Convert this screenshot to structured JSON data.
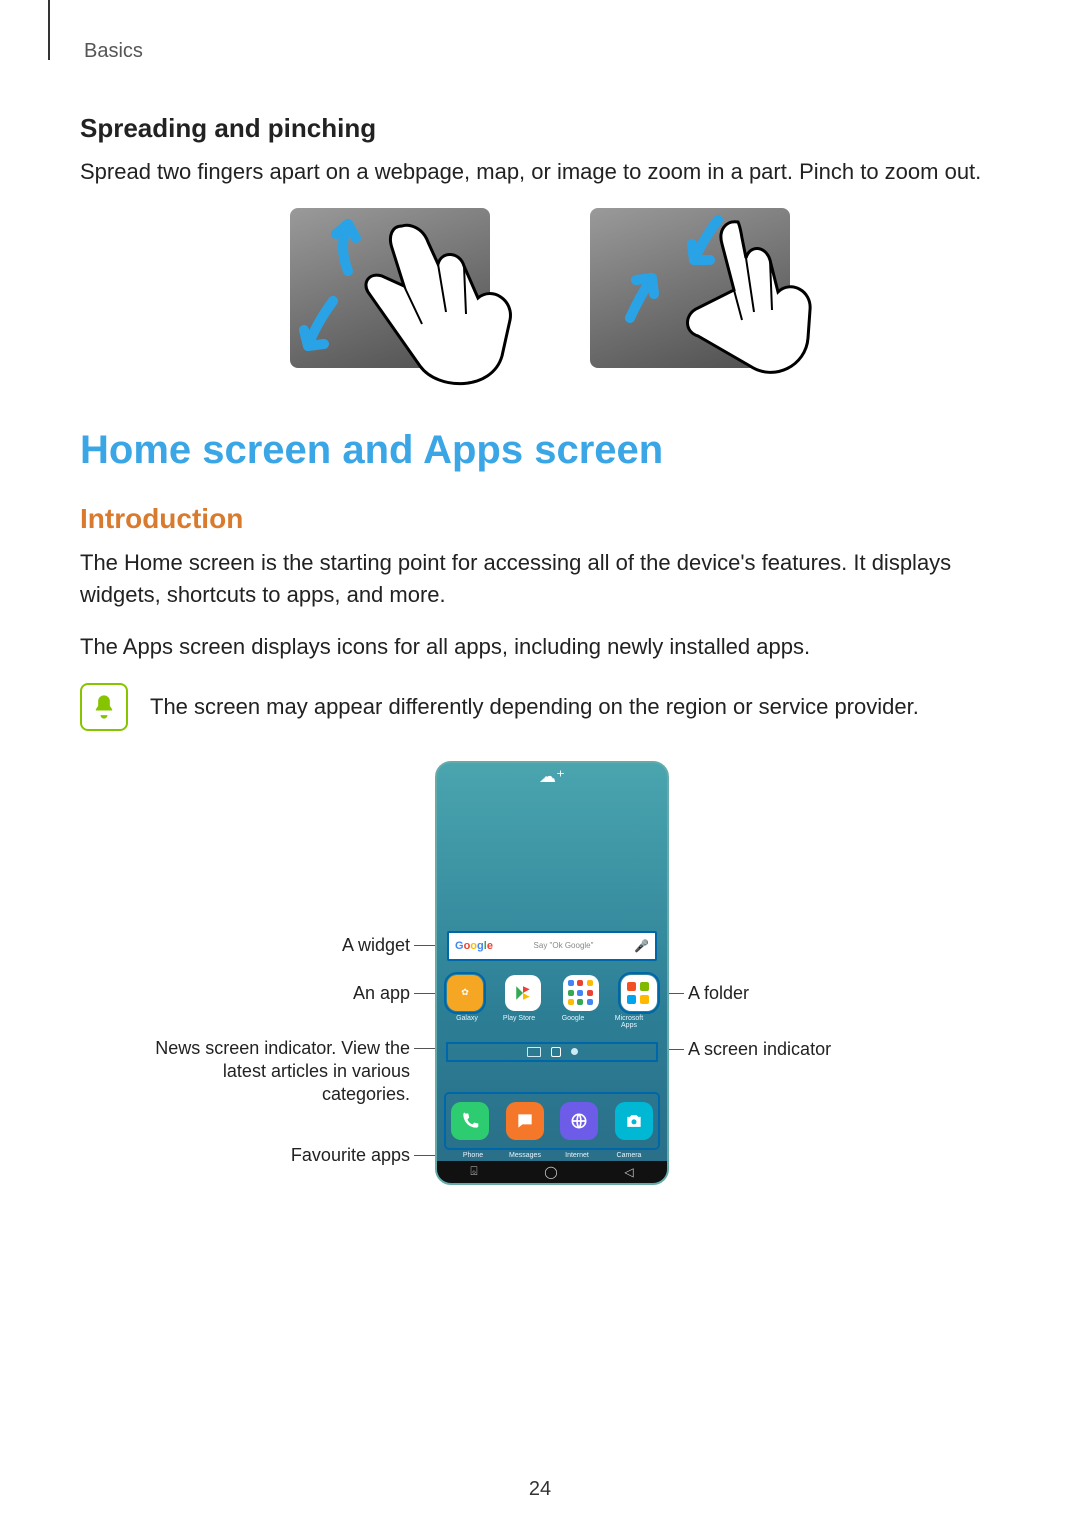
{
  "crumb": "Basics",
  "spreading": {
    "heading": "Spreading and pinching",
    "text": "Spread two fingers apart on a webpage, map, or image to zoom in a part. Pinch to zoom out."
  },
  "main_heading": "Home screen and Apps screen",
  "intro": {
    "heading": "Introduction",
    "p1": "The Home screen is the starting point for accessing all of the device's features. It displays widgets, shortcuts to apps, and more.",
    "p2": "The Apps screen displays icons for all apps, including newly installed apps.",
    "note": "The screen may appear differently depending on the region or service provider."
  },
  "phone": {
    "weather_icon_label": "cloud-plus",
    "search_placeholder": "Say \"Ok Google\"",
    "apps": {
      "galaxy": "Galaxy",
      "play": "Play Store",
      "google": "Google",
      "msapps": "Microsoft Apps"
    },
    "dock": {
      "phone": "Phone",
      "messages": "Messages",
      "internet": "Internet",
      "camera": "Camera"
    }
  },
  "callouts": {
    "widget": "A widget",
    "app": "An app",
    "news": "News screen indicator. View the latest articles in various categories.",
    "fav": "Favourite apps",
    "folder": "A folder",
    "screen_ind": "A screen indicator"
  },
  "page_number": "24"
}
